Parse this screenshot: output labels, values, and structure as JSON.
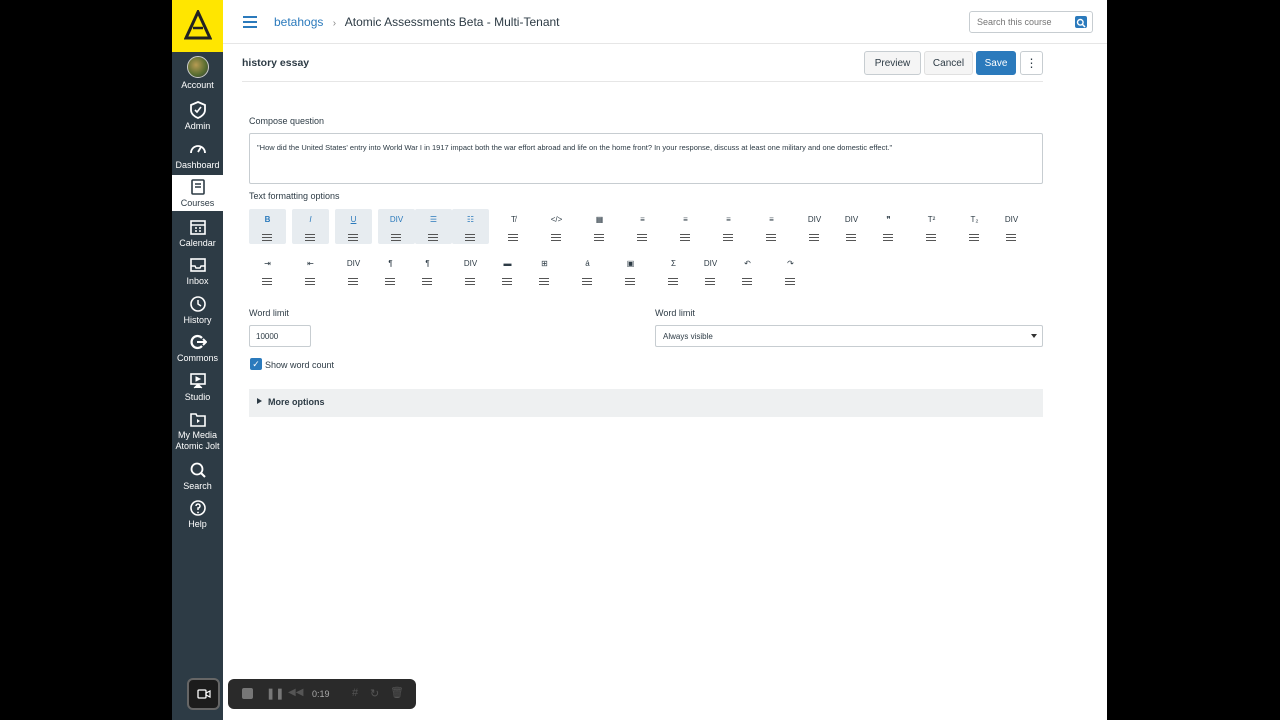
{
  "nav": {
    "items": [
      {
        "label": "Account"
      },
      {
        "label": "Admin"
      },
      {
        "label": "Dashboard"
      },
      {
        "label": "Courses"
      },
      {
        "label": "Calendar"
      },
      {
        "label": "Inbox"
      },
      {
        "label": "History"
      },
      {
        "label": "Commons"
      },
      {
        "label": "Studio"
      },
      {
        "label": "My Media Atomic Jolt"
      },
      {
        "label": "Search"
      },
      {
        "label": "Help"
      }
    ]
  },
  "header": {
    "breadcrumb_link": "betahogs",
    "breadcrumb_current": "Atomic Assessments Beta - Multi-Tenant",
    "search_placeholder": "Search this course"
  },
  "titlebar": {
    "title": "history essay",
    "preview_label": "Preview",
    "cancel_label": "Cancel",
    "save_label": "Save",
    "more_label": "⋮"
  },
  "compose": {
    "label": "Compose question",
    "text": "\"How did the United States' entry into World War I in 1917 impact both the war effort abroad and life on the home front? In your response, discuss at least one military and one domestic effect.\""
  },
  "formatting": {
    "label": "Text formatting options",
    "row1": [
      "B",
      "I",
      "U",
      "DIV",
      "☰",
      "☷",
      "T̸",
      "</>",
      "▦",
      "≡",
      "≡",
      "≡",
      "≡",
      "DIV",
      "DIV",
      "❞",
      "T²",
      "T₂",
      "DIV"
    ],
    "row2": [
      "⇥",
      "⇤",
      "DIV",
      "¶",
      "¶",
      "DIV",
      "▬",
      "⊞",
      "á",
      "▣",
      "Σ",
      "DIV",
      "↶",
      "↷"
    ]
  },
  "word_limit_left": {
    "label": "Word limit",
    "value": "10000"
  },
  "word_limit_right": {
    "label": "Word limit",
    "value": "Always visible"
  },
  "show_word_count": {
    "label": "Show word count",
    "checked": true
  },
  "more_options": {
    "label": "More options"
  },
  "recorder": {
    "time": "0:19"
  }
}
